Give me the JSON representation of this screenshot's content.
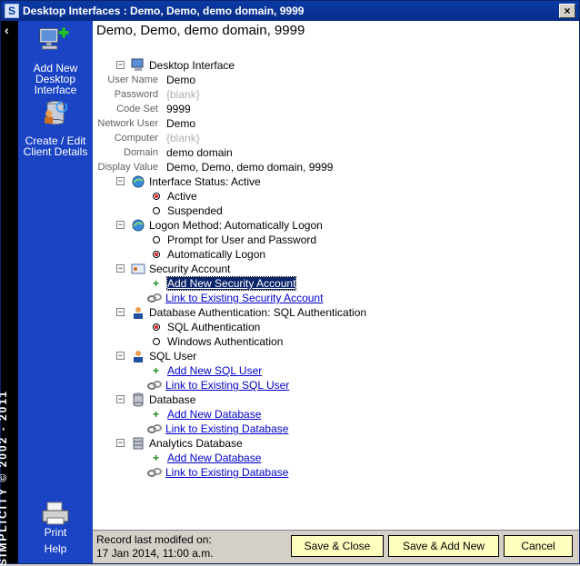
{
  "window": {
    "title": "Desktop Interfaces : Demo, Demo, demo domain, 9999",
    "close": "×"
  },
  "strip": {
    "chevron": "‹",
    "brand": "SIMPLICITY © 2002 - 2011"
  },
  "sidebar": {
    "add_new_desktop_interface": "Add New Desktop Interface",
    "create_edit_client_details": "Create / Edit Client Details",
    "print": "Print",
    "help": "Help"
  },
  "main": {
    "heading": "Demo, Demo, demo domain, 9999",
    "root": "Desktop Interface",
    "fields": [
      {
        "label": "User Name",
        "value": "Demo",
        "blank": false
      },
      {
        "label": "Password",
        "value": "{blank}",
        "blank": true
      },
      {
        "label": "Code Set",
        "value": "9999",
        "blank": false
      },
      {
        "label": "Network User",
        "value": "Demo",
        "blank": false
      },
      {
        "label": "Computer",
        "value": "{blank}",
        "blank": true
      },
      {
        "label": "Domain",
        "value": "demo domain",
        "blank": false
      },
      {
        "label": "Display Value",
        "value": "Demo, Demo, demo domain, 9999",
        "blank": false
      }
    ],
    "interface_status": {
      "label": "Interface Status:  Active",
      "options": [
        "Active",
        "Suspended"
      ]
    },
    "logon_method": {
      "label": "Logon Method:  Automatically Logon",
      "options": [
        "Prompt for User and Password",
        "Automatically Logon"
      ]
    },
    "security_account": {
      "label": "Security Account",
      "add": "Add New Security Account",
      "link": "Link to Existing Security Account"
    },
    "database_authentication": {
      "label": "Database Authentication:  SQL Authentication",
      "options": [
        "SQL Authentication",
        "Windows Authentication"
      ]
    },
    "sql_user": {
      "label": "SQL User",
      "add": "Add New SQL User",
      "link": "Link to Existing SQL User"
    },
    "database": {
      "label": "Database",
      "add": "Add New Database",
      "link": "Link to Existing Database"
    },
    "analytics_database": {
      "label": "Analytics Database",
      "add": "Add New Database",
      "link": "Link to Existing Database"
    }
  },
  "footer": {
    "record_label": "Record last modifed on:",
    "record_date": "17 Jan 2014, 11:00 a.m.",
    "save_close": "Save & Close",
    "save_add_new": "Save & Add New",
    "cancel": "Cancel"
  },
  "colors": {
    "sidebar": "#1a44c4",
    "titlebar": "#0b3aa6",
    "button": "#ffffc0",
    "link": "#0000cc",
    "radio_on": "#e02020"
  }
}
